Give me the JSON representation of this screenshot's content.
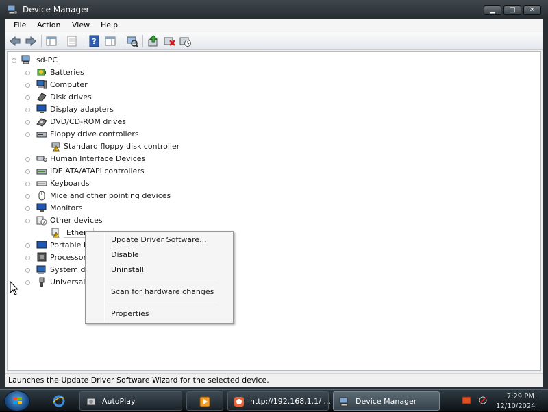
{
  "window": {
    "title": "Device Manager"
  },
  "menu": [
    "File",
    "Action",
    "View",
    "Help"
  ],
  "toolbar": {
    "icons": [
      "back-icon",
      "forward-icon",
      "show-hide-console-tree-icon",
      "properties-icon",
      "help-icon",
      "action-pane-icon",
      "scan-hardware-icon",
      "update-driver-icon",
      "uninstall-icon",
      "disable-icon"
    ]
  },
  "tree": {
    "root": "sd-PC",
    "items": [
      {
        "label": "Batteries",
        "icon": "battery-icon"
      },
      {
        "label": "Computer",
        "icon": "computer-icon"
      },
      {
        "label": "Disk drives",
        "icon": "disk-drive-icon"
      },
      {
        "label": "Display adapters",
        "icon": "display-adapter-icon"
      },
      {
        "label": "DVD/CD-ROM drives",
        "icon": "dvd-drive-icon"
      },
      {
        "label": "Floppy drive controllers",
        "icon": "floppy-controller-icon"
      },
      {
        "label": "Standard floppy disk controller",
        "icon": "floppy-warning-icon",
        "child": true
      },
      {
        "label": "Human Interface Devices",
        "icon": "hid-icon"
      },
      {
        "label": "IDE ATA/ATAPI controllers",
        "icon": "ide-controller-icon"
      },
      {
        "label": "Keyboards",
        "icon": "keyboard-icon"
      },
      {
        "label": "Mice and other pointing devices",
        "icon": "mouse-icon"
      },
      {
        "label": "Monitors",
        "icon": "monitor-icon"
      },
      {
        "label": "Other devices",
        "icon": "other-devices-icon"
      },
      {
        "label": "Ethern",
        "icon": "ethernet-warning-icon",
        "child": true,
        "selected": true
      },
      {
        "label": "Portable D",
        "icon": "portable-device-icon"
      },
      {
        "label": "Processors",
        "icon": "processor-icon"
      },
      {
        "label": "System de",
        "icon": "system-device-icon"
      },
      {
        "label": "Universal S",
        "icon": "usb-icon"
      }
    ]
  },
  "context_menu": {
    "items": [
      "Update Driver Software...",
      "Disable",
      "Uninstall",
      "Scan for hardware changes",
      "Properties"
    ]
  },
  "status": {
    "text": "Launches the Update Driver Software Wizard for the selected device."
  },
  "taskbar": {
    "tasks": [
      {
        "label": "AutoPlay",
        "icon": "autoplay-icon",
        "active": false
      },
      {
        "label": "",
        "icon": "media-player-icon",
        "active": false
      },
      {
        "label": "http://192.168.1.1/ ...",
        "icon": "browser-icon",
        "active": false
      },
      {
        "label": "Device Manager",
        "icon": "device-manager-icon",
        "active": true
      }
    ],
    "time": "7:29 PM",
    "date": "12/10/2024"
  }
}
